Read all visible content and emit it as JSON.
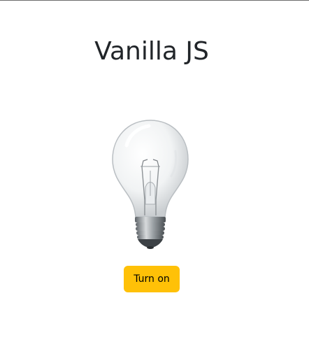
{
  "page": {
    "title": "Vanilla JS"
  },
  "bulb": {
    "icon": "light-bulb-icon",
    "state": "off"
  },
  "toggle": {
    "label": "Turn on",
    "color": "#ffc107"
  }
}
